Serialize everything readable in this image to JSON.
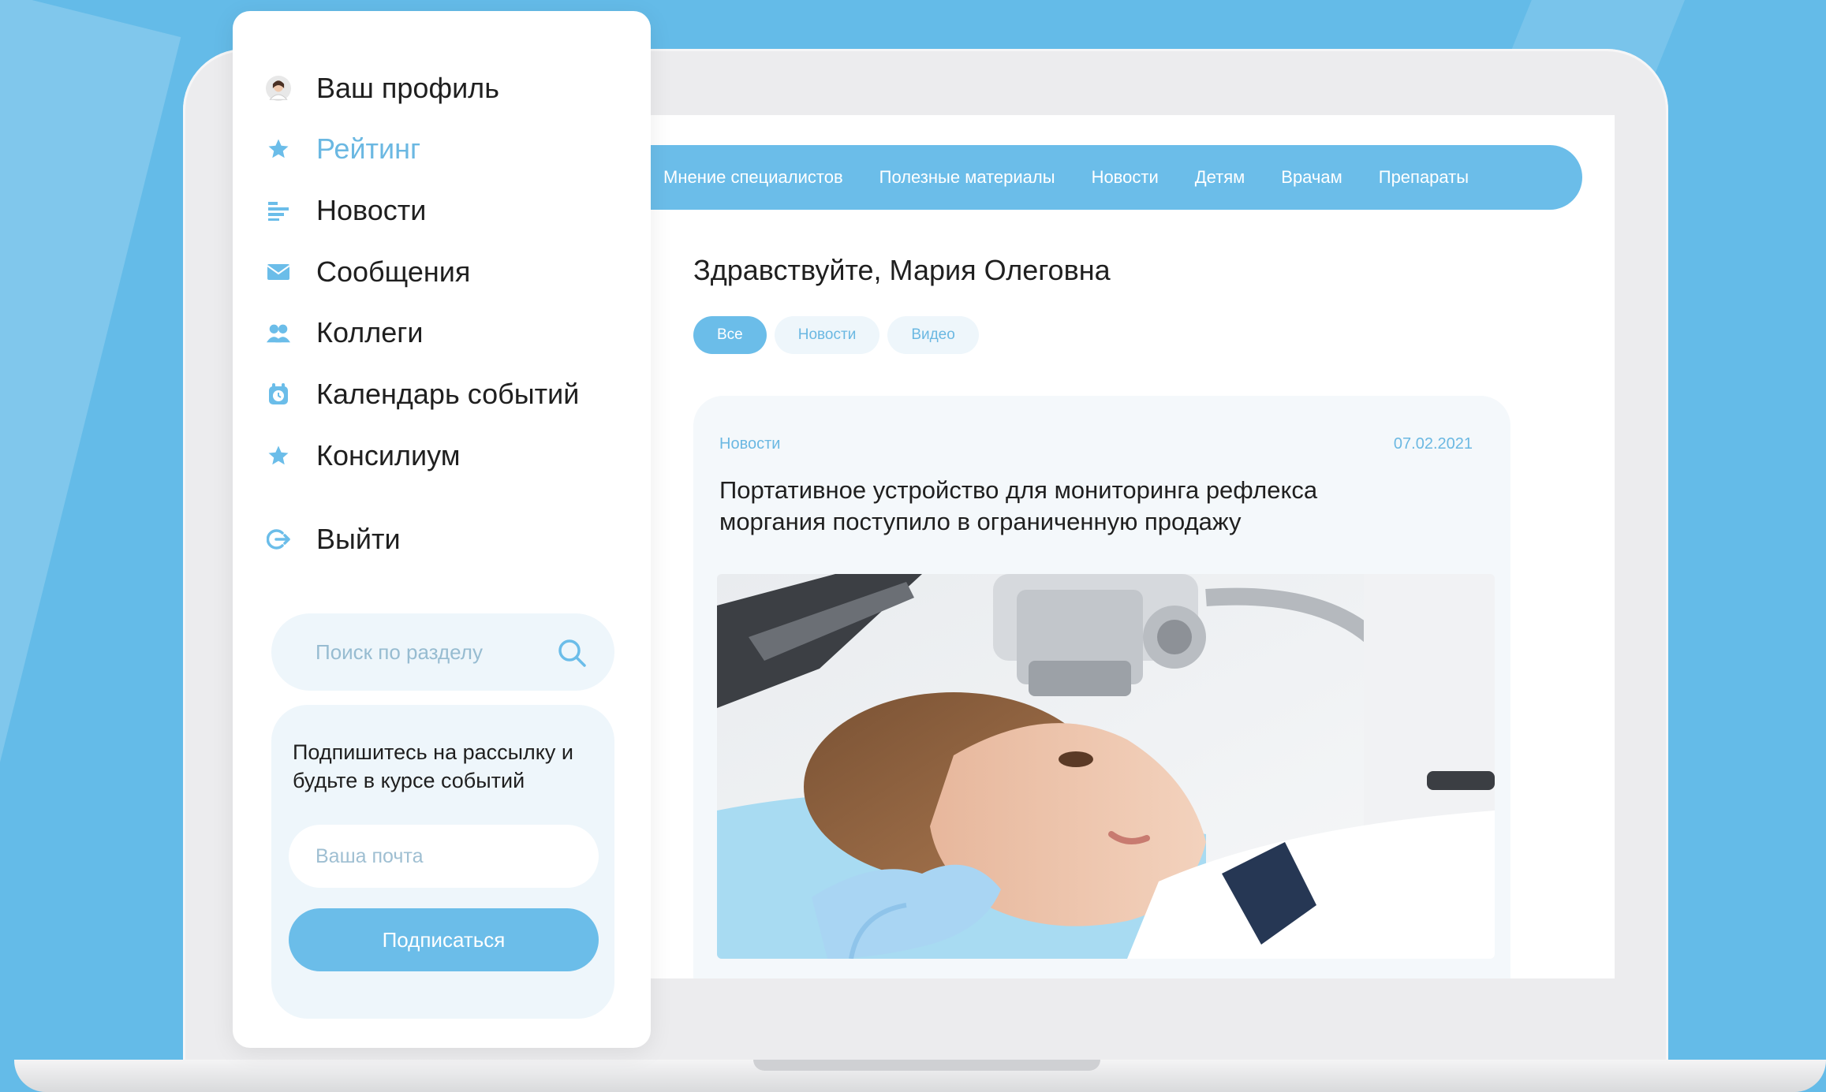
{
  "colors": {
    "accent": "#6bbde9",
    "background": "#64bbe8",
    "text": "#1f1f1f"
  },
  "sidebar": {
    "items": [
      {
        "label": "Ваш профиль",
        "icon": "avatar-icon"
      },
      {
        "label": "Рейтинг",
        "icon": "star-icon",
        "active": true
      },
      {
        "label": "Новости",
        "icon": "news-icon"
      },
      {
        "label": "Сообщения",
        "icon": "envelope-icon"
      },
      {
        "label": "Коллеги",
        "icon": "users-icon"
      },
      {
        "label": "Календарь событий",
        "icon": "alarm-clock-icon"
      },
      {
        "label": "Консилиум",
        "icon": "star-icon"
      },
      {
        "label": "Выйти",
        "icon": "logout-icon"
      }
    ],
    "search": {
      "placeholder": "Поиск по разделу",
      "icon": "search-icon"
    },
    "subscribe": {
      "text": "Подпишитесь на рассылку и будьте в курсе событий",
      "email_placeholder": "Ваша почта",
      "button_label": "Подписаться"
    }
  },
  "topnav": {
    "items": [
      "Мнение специалистов",
      "Полезные материалы",
      "Новости",
      "Детям",
      "Врачам",
      "Препараты"
    ]
  },
  "main": {
    "greeting": "Здравствуйте, Мария Олеговна",
    "filters": [
      {
        "label": "Все",
        "active": true
      },
      {
        "label": "Новости",
        "active": false
      },
      {
        "label": "Видео",
        "active": false
      }
    ],
    "card": {
      "category": "Новости",
      "date": "07.02.2021",
      "title": "Портативное устройство для мониторинга рефлекса моргания поступило в ограниченную продажу"
    }
  }
}
